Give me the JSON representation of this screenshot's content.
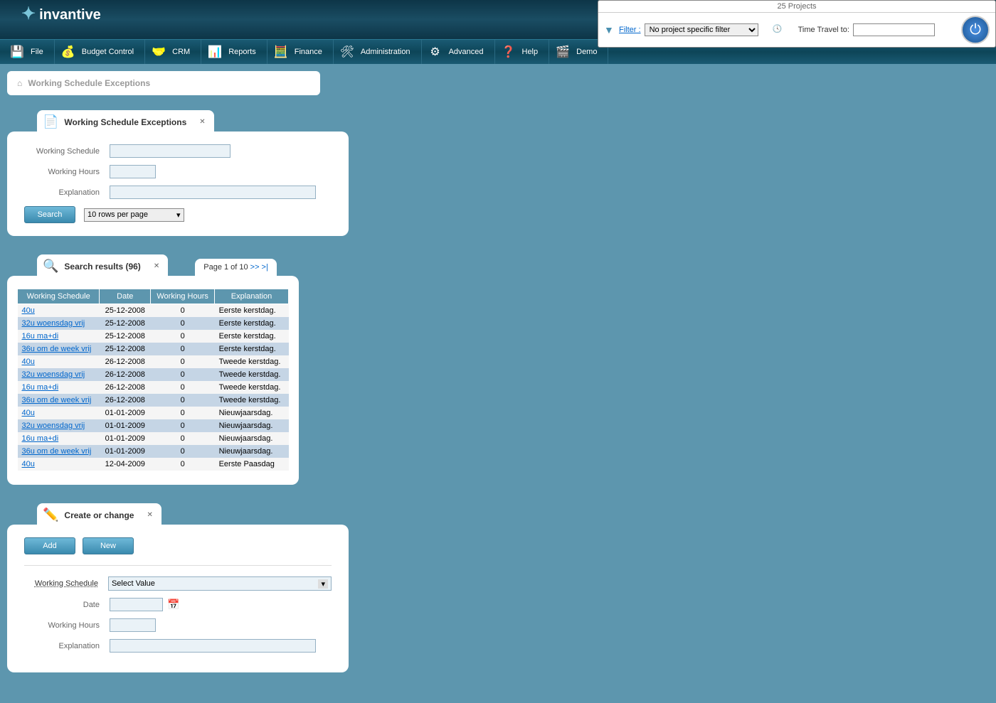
{
  "topbar": {
    "projects": "25 Projects",
    "filter_label": "Filter",
    "filter_value": "No project specific filter",
    "timetravel_label": "Time Travel to:"
  },
  "menu": {
    "file": "File",
    "budget": "Budget Control",
    "crm": "CRM",
    "reports": "Reports",
    "finance": "Finance",
    "admin": "Administration",
    "advanced": "Advanced",
    "help": "Help",
    "demo": "Demo"
  },
  "breadcrumb": "Working Schedule Exceptions",
  "search_panel": {
    "title": "Working Schedule Exceptions",
    "label_ws": "Working Schedule",
    "label_wh": "Working Hours",
    "label_ex": "Explanation",
    "btn": "Search",
    "rows": "10 rows per page"
  },
  "results": {
    "title": "Search results (96)",
    "page": "Page 1 of 10",
    "next": ">>",
    "last": ">|",
    "cols": {
      "ws": "Working Schedule",
      "date": "Date",
      "wh": "Working Hours",
      "ex": "Explanation"
    },
    "rows": [
      {
        "ws": "40u",
        "date": "25-12-2008",
        "wh": "0",
        "ex": "Eerste kerstdag."
      },
      {
        "ws": "32u woensdag vrij",
        "date": "25-12-2008",
        "wh": "0",
        "ex": "Eerste kerstdag."
      },
      {
        "ws": "16u ma+di",
        "date": "25-12-2008",
        "wh": "0",
        "ex": "Eerste kerstdag."
      },
      {
        "ws": "36u om de week vrij",
        "date": "25-12-2008",
        "wh": "0",
        "ex": "Eerste kerstdag."
      },
      {
        "ws": "40u",
        "date": "26-12-2008",
        "wh": "0",
        "ex": "Tweede kerstdag."
      },
      {
        "ws": "32u woensdag vrij",
        "date": "26-12-2008",
        "wh": "0",
        "ex": "Tweede kerstdag."
      },
      {
        "ws": "16u ma+di",
        "date": "26-12-2008",
        "wh": "0",
        "ex": "Tweede kerstdag."
      },
      {
        "ws": "36u om de week vrij",
        "date": "26-12-2008",
        "wh": "0",
        "ex": "Tweede kerstdag."
      },
      {
        "ws": "40u",
        "date": "01-01-2009",
        "wh": "0",
        "ex": "Nieuwjaarsdag."
      },
      {
        "ws": "32u woensdag vrij",
        "date": "01-01-2009",
        "wh": "0",
        "ex": "Nieuwjaarsdag."
      },
      {
        "ws": "16u ma+di",
        "date": "01-01-2009",
        "wh": "0",
        "ex": "Nieuwjaarsdag."
      },
      {
        "ws": "36u om de week vrij",
        "date": "01-01-2009",
        "wh": "0",
        "ex": "Nieuwjaarsdag."
      },
      {
        "ws": "40u",
        "date": "12-04-2009",
        "wh": "0",
        "ex": "Eerste Paasdag"
      }
    ]
  },
  "create": {
    "title": "Create or change",
    "btn_add": "Add",
    "btn_new": "New",
    "label_ws": "Working Schedule",
    "label_date": "Date",
    "label_wh": "Working Hours",
    "label_ex": "Explanation",
    "sv": "Select Value"
  }
}
